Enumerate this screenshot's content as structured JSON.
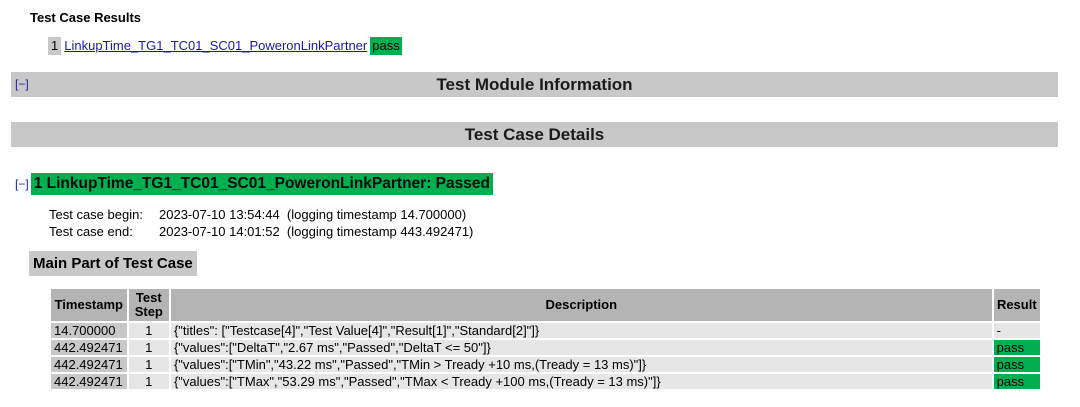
{
  "test_case_results": {
    "title": "Test Case Results",
    "items": [
      {
        "num": "1",
        "name": "LinkupTime_TG1_TC01_SC01_PoweronLinkPartner",
        "result": "pass"
      }
    ]
  },
  "module_info": {
    "toggle": "[−]",
    "title": "Test Module Information"
  },
  "case_details": {
    "title": "Test Case Details"
  },
  "case": {
    "toggle": "[−]",
    "title": "1 LinkupTime_TG1_TC01_SC01_PoweronLinkPartner: Passed",
    "begin_label": "Test case begin:",
    "begin_value": "2023-07-10 13:54:44  (logging timestamp 14.700000)",
    "end_label": "Test case end:",
    "end_value": "2023-07-10 14:01:52  (logging timestamp 443.492471)",
    "main_part": "Main Part of Test Case"
  },
  "table": {
    "headers": {
      "timestamp": "Timestamp",
      "step_1": "Test",
      "step_2": "Step",
      "description": "Description",
      "result": "Result"
    },
    "rows": [
      {
        "timestamp": "14.700000",
        "step": "1",
        "description": "{\"titles\": [\"Testcase[4]\",\"Test Value[4]\",\"Result[1]\",\"Standard[2]\"]}",
        "result": "-"
      },
      {
        "timestamp": "442.492471",
        "step": "1",
        "description": "{\"values\":[\"DeltaT\",\"2.67 ms\",\"Passed\",\"DeltaT <= 50\"]}",
        "result": "pass"
      },
      {
        "timestamp": "442.492471",
        "step": "1",
        "description": "{\"values\":[\"TMin\",\"43.22 ms\",\"Passed\",\"TMin > Tready +10 ms,(Tready = 13 ms)\"]}",
        "result": "pass"
      },
      {
        "timestamp": "442.492471",
        "step": "1",
        "description": "{\"values\":[\"TMax\",\"53.29 ms\",\"Passed\",\"TMax < Tready +100 ms,(Tready = 13 ms)\"]}",
        "result": "pass"
      }
    ]
  },
  "colors": {
    "pass": "#00b050",
    "header_bar": "#c8c8c8",
    "link": "#1a1aa6"
  }
}
